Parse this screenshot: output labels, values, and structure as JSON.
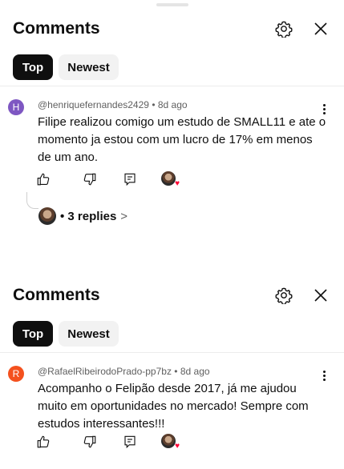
{
  "panels": [
    {
      "header": {
        "title": "Comments"
      },
      "tabs": [
        {
          "label": "Top"
        },
        {
          "label": "Newest"
        }
      ],
      "comment": {
        "avatar_letter": "H",
        "author": "@henriquefernandes2429",
        "age": "8d ago",
        "text": "Filipe realizou comigo um estudo de SMALL11 e ate o momento ja estou com um lucro de 17% em menos de um ano.",
        "replies_label": "• 3 replies",
        "replies_chevron": ">"
      }
    },
    {
      "header": {
        "title": "Comments"
      },
      "tabs": [
        {
          "label": "Top"
        },
        {
          "label": "Newest"
        }
      ],
      "comment": {
        "avatar_letter": "R",
        "author": "@RafaelRibeirodoPrado-pp7bz",
        "age": "8d ago",
        "text": "Acompanho o Felipão desde 2017, já me ajudou muito em oportunidades no mercado! Sempre com estudos interessantes!!!"
      }
    }
  ],
  "meta_separator": "•",
  "icons": [
    "settings-gear-icon",
    "close-icon",
    "thumbs-up-icon",
    "thumbs-down-icon",
    "reply-icon",
    "creator-heart-icon",
    "more-vert-icon"
  ],
  "colors": {
    "avatar_h": "#7e57c2",
    "avatar_r": "#f4511e",
    "heart": "#ff0033",
    "chip_active": "#0f0f0f"
  }
}
